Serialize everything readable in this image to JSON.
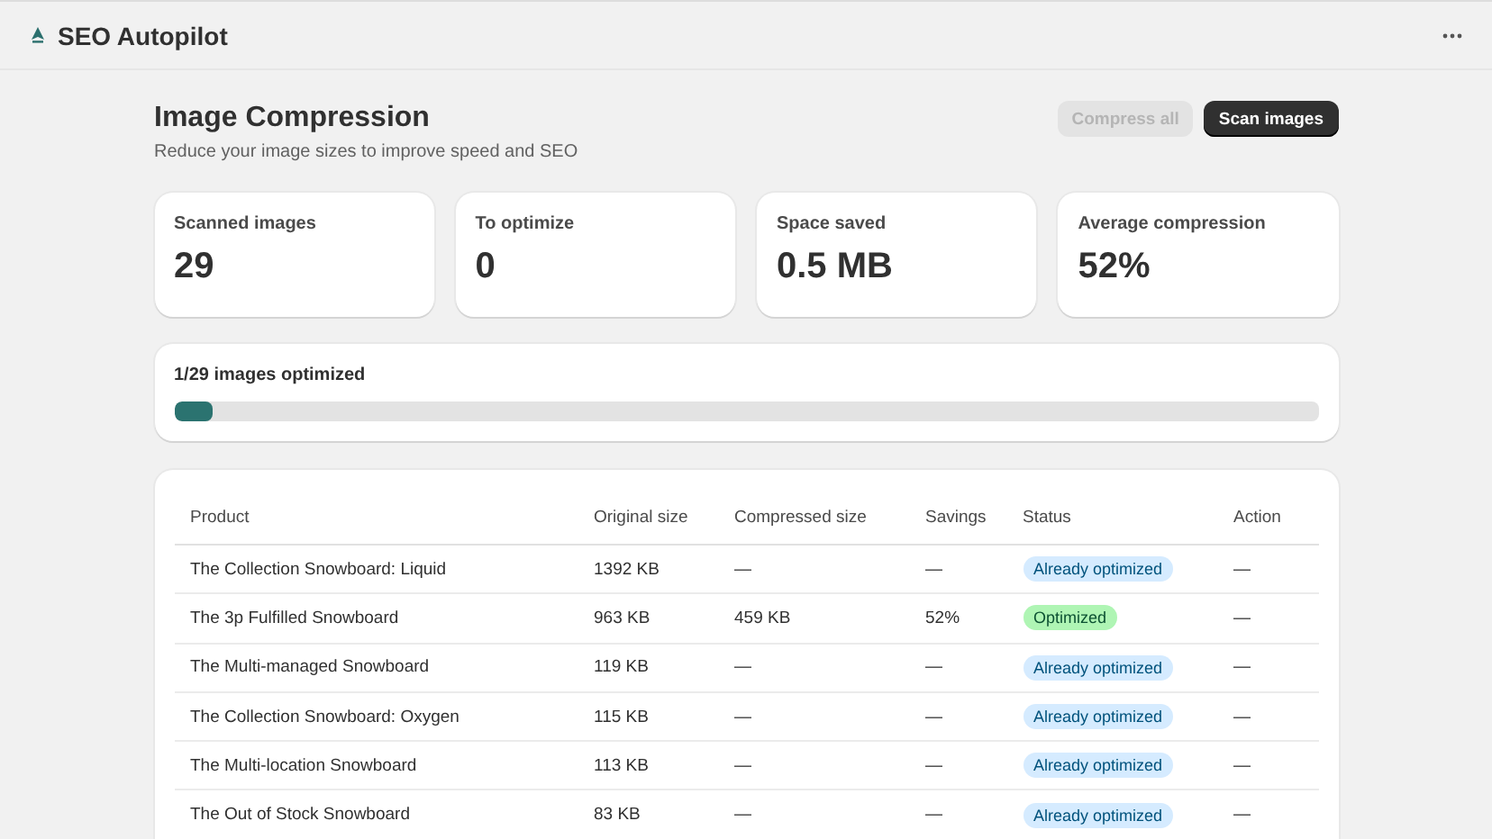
{
  "app": {
    "title": "SEO Autopilot"
  },
  "page": {
    "title": "Image Compression",
    "subtitle": "Reduce your image sizes to improve speed and SEO"
  },
  "buttons": [
    {
      "label": "Compress all",
      "kind": "secondary",
      "disabled": true
    },
    {
      "label": "Scan images",
      "kind": "primary",
      "disabled": false
    }
  ],
  "stats": [
    {
      "label": "Scanned images",
      "value": "29"
    },
    {
      "label": "To optimize",
      "value": "0"
    },
    {
      "label": "Space saved",
      "value": "0.5 MB"
    },
    {
      "label": "Average compression",
      "value": "52%"
    }
  ],
  "progress": {
    "label": "1/29 images optimized",
    "level": 0.034
  },
  "table": {
    "columns": [
      "Product",
      "Original size",
      "Compressed size",
      "Savings",
      "Status",
      "Action"
    ],
    "rows": [
      {
        "product": "The Collection Snowboard: Liquid",
        "original": "1392 KB",
        "compressed": "—",
        "savings": "—",
        "status": "Already optimized",
        "kind": "info",
        "action": "—"
      },
      {
        "product": "The 3p Fulfilled Snowboard",
        "original": "963 KB",
        "compressed": "459 KB",
        "savings": "52%",
        "status": "Optimized",
        "kind": "success",
        "action": "—"
      },
      {
        "product": "The Multi-managed Snowboard",
        "original": "119 KB",
        "compressed": "—",
        "savings": "—",
        "status": "Already optimized",
        "kind": "info",
        "action": "—"
      },
      {
        "product": "The Collection Snowboard: Oxygen",
        "original": "115 KB",
        "compressed": "—",
        "savings": "—",
        "status": "Already optimized",
        "kind": "info",
        "action": "—"
      },
      {
        "product": "The Multi-location Snowboard",
        "original": "113 KB",
        "compressed": "—",
        "savings": "—",
        "status": "Already optimized",
        "kind": "info",
        "action": "—"
      },
      {
        "product": "The Out of Stock Snowboard",
        "original": "83 KB",
        "compressed": "—",
        "savings": "—",
        "status": "Already optimized",
        "kind": "info",
        "action": "—"
      }
    ]
  }
}
